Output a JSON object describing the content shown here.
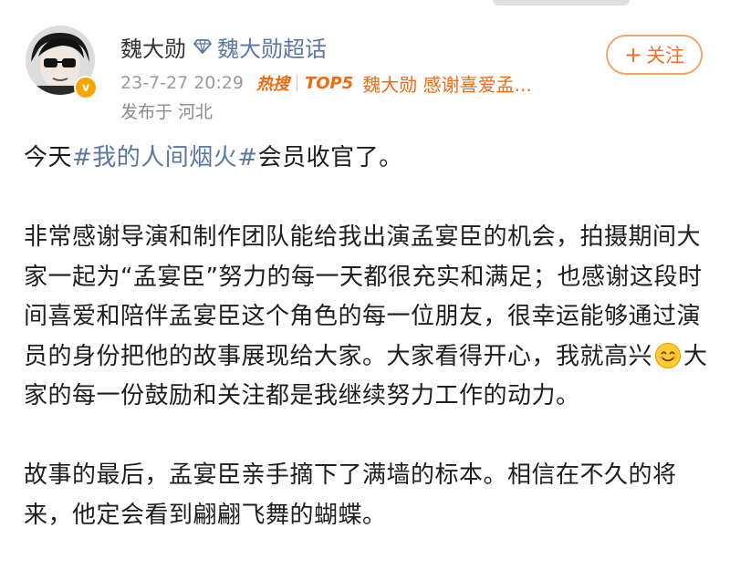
{
  "header": {
    "user_name": "魏大勋",
    "topic_link": "魏大勋超话",
    "timestamp": "23-7-27 20:29",
    "hot_search": "热搜",
    "top_rank": "TOP5",
    "hot_topic": "魏大勋 感谢喜爱孟...",
    "location": "发布于 河北",
    "verified_badge": "v",
    "follow_label": "关注",
    "follow_plus": "+"
  },
  "post": {
    "p1_prefix": "今天",
    "p1_hashtag": "#我的人间烟火#",
    "p1_suffix": "会员收官了。",
    "p2_text": "非常感谢导演和制作团队能给我出演孟宴臣的机会，拍摄期间大家一起为“孟宴臣”努力的每一天都很充实和满足；也感谢这段时间喜爱和陪伴孟宴臣这个角色的每一位朋友，很幸运能够通过演员的身份把他的故事展现给大家。大家看得开心，我就高兴",
    "p2_text_after_emoji": "大家的每一份鼓励和关注都是我继续努力工作的动力。",
    "p3_text": "故事的最后，孟宴臣亲手摘下了满墙的标本。相信在不久的将来，他定会看到翩翩飞舞的蝴蝶。"
  },
  "icons": {
    "diamond": "diamond-icon",
    "smile": "smile-emoji-icon",
    "avatar": "avatar-image"
  },
  "colors": {
    "link": "#5b77a5",
    "accent_orange": "#f07028",
    "meta_gray": "#9a9a9a"
  }
}
